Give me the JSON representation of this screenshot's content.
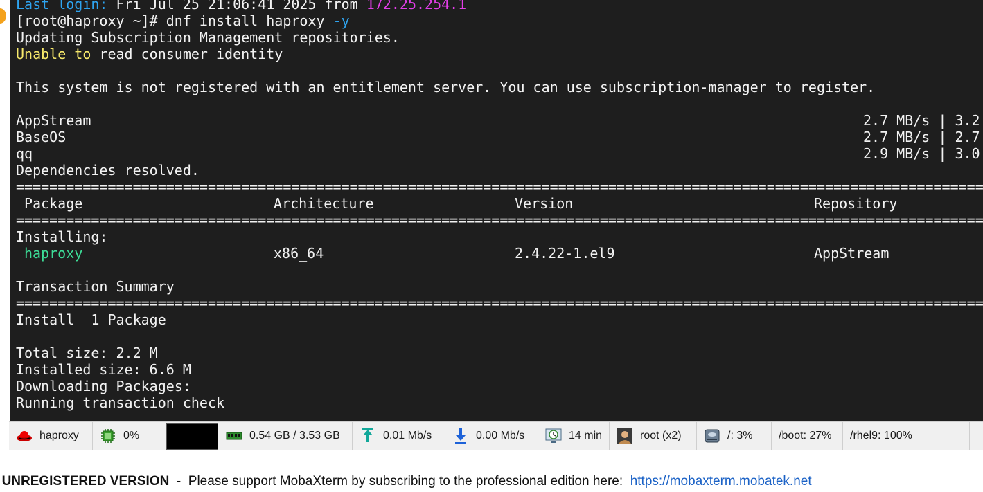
{
  "terminal": {
    "last_login_label": "Last login:",
    "last_login_date": "Fri Jul 25 21:06:41 2025 from ",
    "last_login_ip": "172.25.254.1",
    "prompt": "[root@haproxy ~]# ",
    "command": "dnf install haproxy ",
    "command_flag": "-y",
    "updating": "Updating Subscription Management repositories.",
    "unable_1": "Unable to",
    "unable_2": " read consumer identity",
    "not_registered": "This system is not registered with an entitlement server. You can use subscription-manager to register.",
    "repos": [
      {
        "name": "AppStream",
        "speed": "2.7 MB/s | 3.2"
      },
      {
        "name": "BaseOS",
        "speed": "2.7 MB/s | 2.7"
      },
      {
        "name": "qq",
        "speed": "2.9 MB/s | 3.0"
      }
    ],
    "deps_resolved": "Dependencies resolved.",
    "separator": "==============================================================================================================================================================",
    "headers": {
      "package": "Package",
      "architecture": "Architecture",
      "version": "Version",
      "repository": "Repository"
    },
    "installing_label": "Installing:",
    "package_row": {
      "name": "haproxy",
      "arch": "x86_64",
      "version": "2.4.22-1.el9",
      "repo": "AppStream"
    },
    "transaction_summary": "Transaction Summary",
    "install_count": "Install  1 Package",
    "total_size": "Total size: 2.2 M",
    "installed_size": "Installed size: 6.6 M",
    "downloading": "Downloading Packages:",
    "running_check": "Running transaction check"
  },
  "statusbar": {
    "host": "haproxy",
    "cpu": "0%",
    "memory": "0.54 GB / 3.53 GB",
    "upload": "0.01 Mb/s",
    "download": "0.00 Mb/s",
    "uptime": "14 min",
    "user": "root  (x2)",
    "disk_root": "/: 3%",
    "disk_boot": "/boot: 27%",
    "disk_rhel9": "/rhel9: 100%"
  },
  "footer": {
    "unregistered": "UNREGISTERED VERSION",
    "dash": "  -  ",
    "message": "Please support MobaXterm by subscribing to the professional edition here:  ",
    "link": "https://mobaxterm.mobatek.net"
  },
  "colors": {
    "terminal_bg": "#1e1e1e",
    "login_label": "#2ea4f0",
    "ip": "#e23ee8",
    "warning": "#f7e96b",
    "package_name": "#3ddc97",
    "link": "#1b62c6"
  }
}
